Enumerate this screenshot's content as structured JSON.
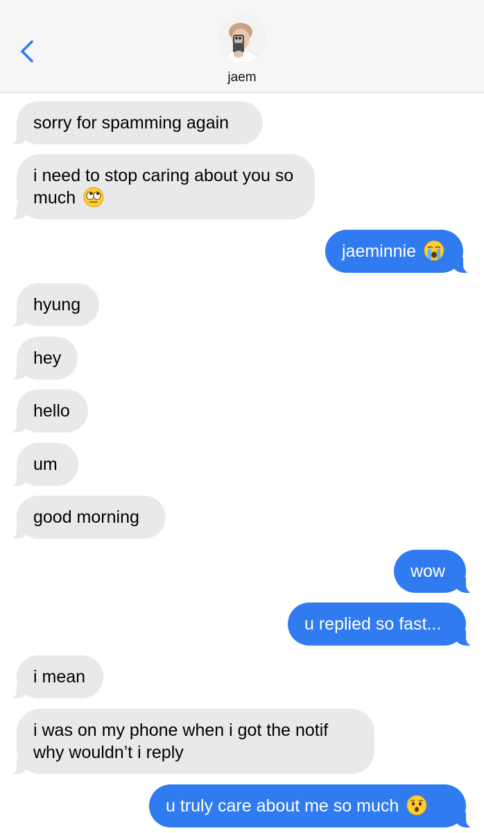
{
  "header": {
    "contact_name": "jaem",
    "back_icon": "chevron-left-icon",
    "accent_color": "#2f7bef"
  },
  "messages": [
    {
      "direction": "incoming",
      "text": "sorry for spamming again"
    },
    {
      "direction": "incoming",
      "text": "i need to stop caring about you so much",
      "emoji": "eye-roll-emoji"
    },
    {
      "direction": "outgoing",
      "text": "jaeminnie",
      "emoji": "loudly-crying-emoji"
    },
    {
      "direction": "incoming",
      "text": "hyung"
    },
    {
      "direction": "incoming",
      "text": "hey"
    },
    {
      "direction": "incoming",
      "text": "hello"
    },
    {
      "direction": "incoming",
      "text": "um"
    },
    {
      "direction": "incoming",
      "text": "good morning"
    },
    {
      "direction": "outgoing",
      "text": "wow"
    },
    {
      "direction": "outgoing",
      "text": "u replied so fast..."
    },
    {
      "direction": "incoming",
      "text": "i mean"
    },
    {
      "direction": "incoming",
      "text": "i was on my phone when i got the notif why wouldn’t i reply"
    },
    {
      "direction": "outgoing",
      "text": "u truly care about me so much",
      "emoji": "hushed-face-emoji"
    }
  ],
  "colors": {
    "incoming_bubble": "#e9e9eb",
    "outgoing_bubble": "#2f7bef",
    "header_background": "#f6f6f6"
  }
}
